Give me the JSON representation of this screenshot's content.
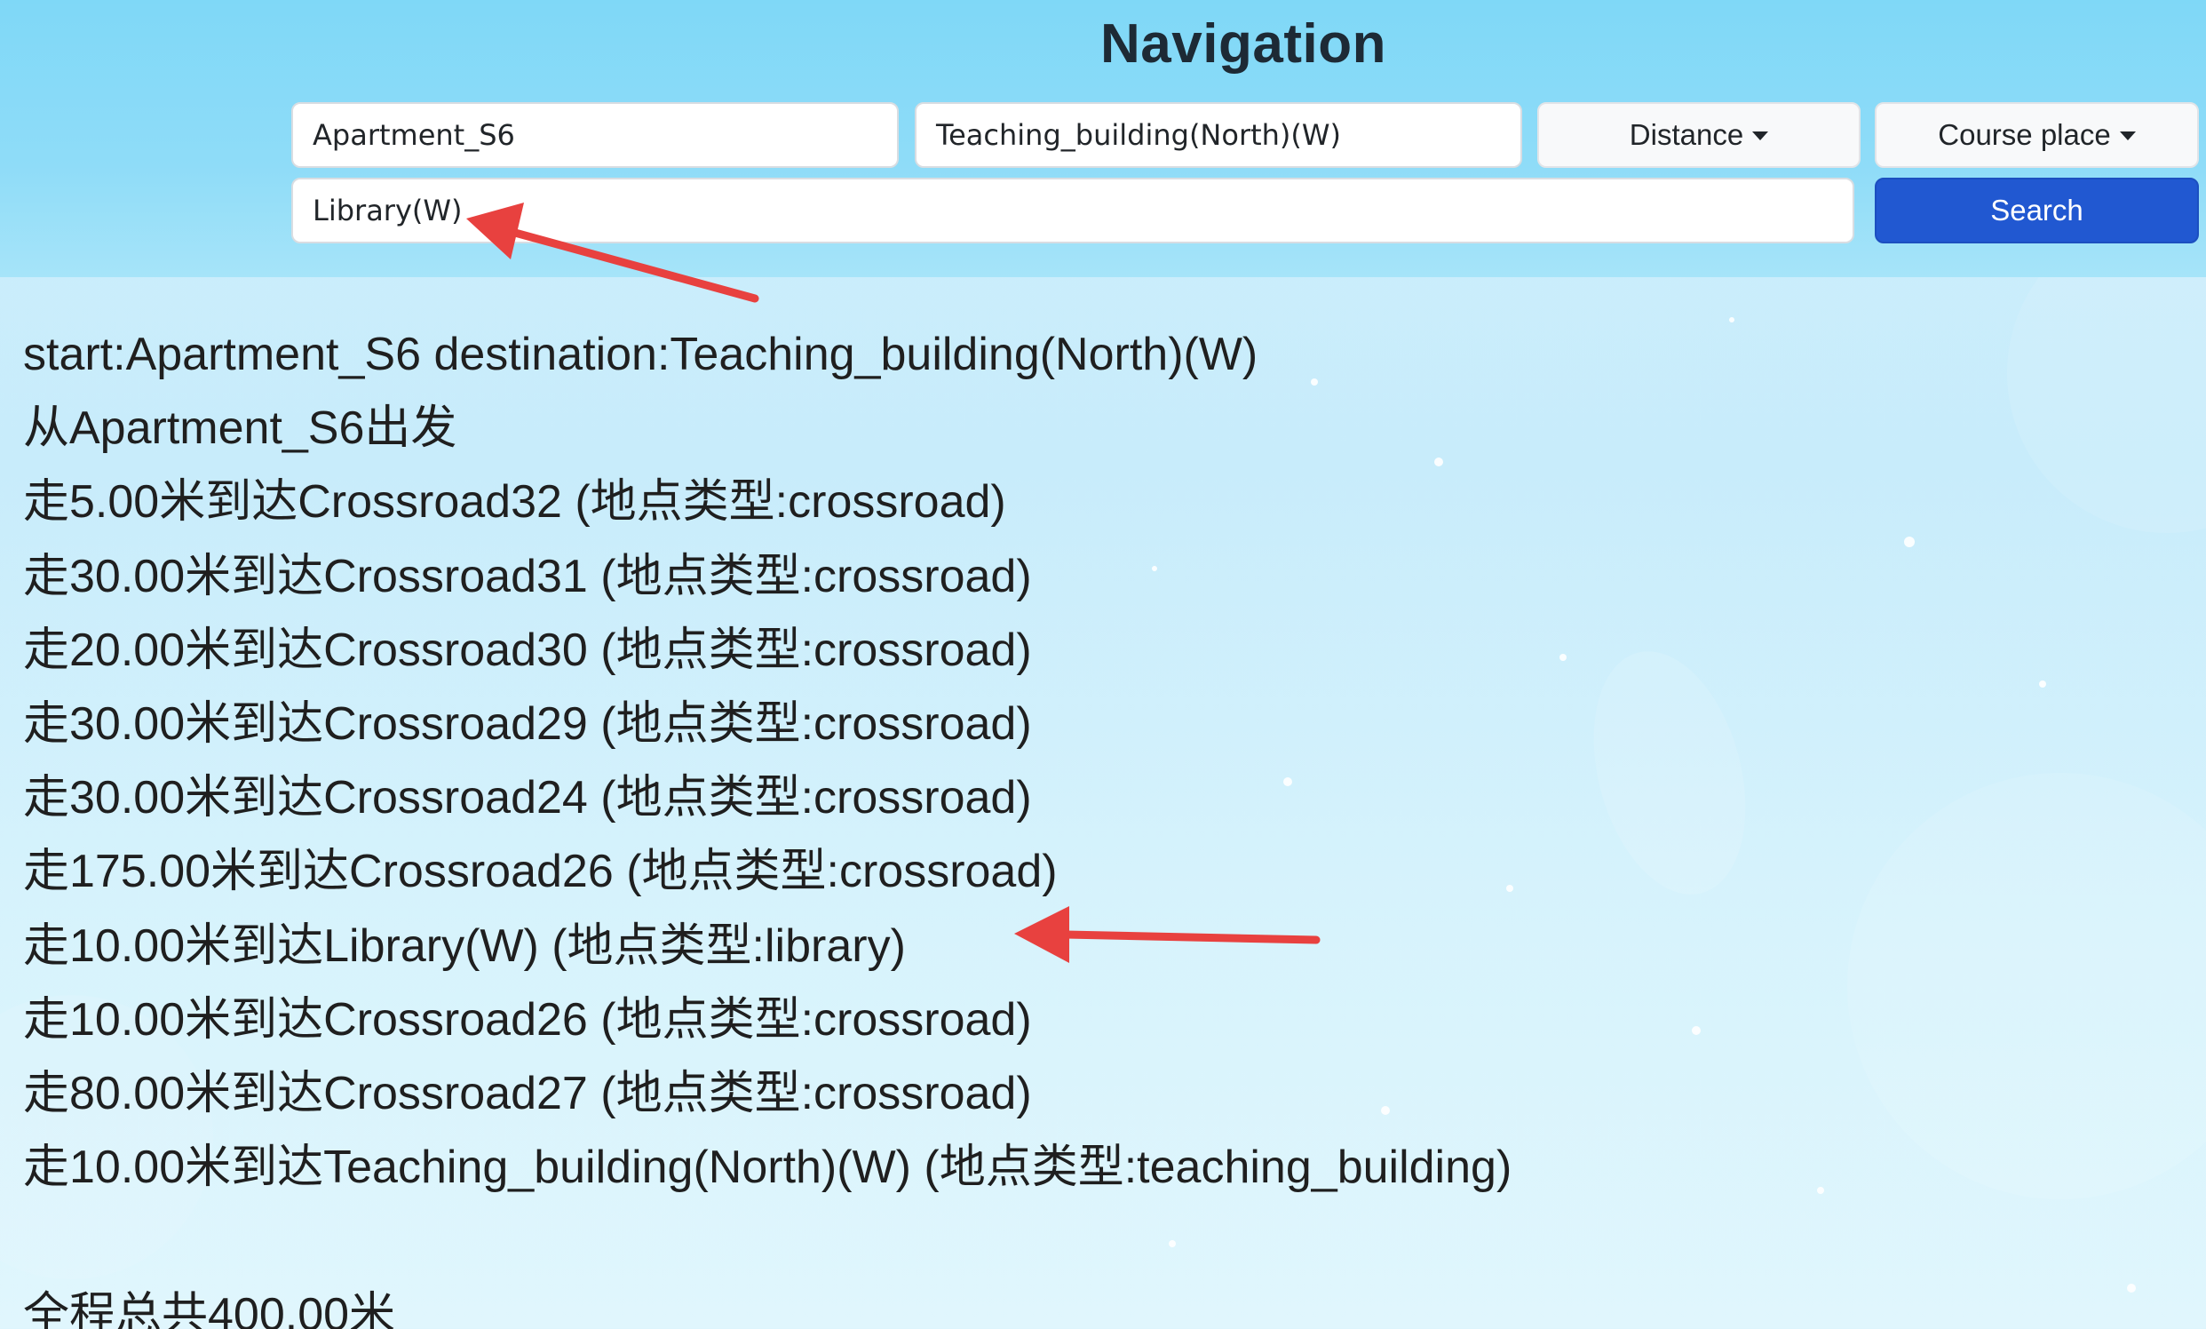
{
  "page": {
    "title": "Navigation"
  },
  "form": {
    "start_value": "Apartment_S6",
    "destination_value": "Teaching_building(North)(W)",
    "waypoint_value": "Library(W)",
    "distance_dropdown_label": "Distance",
    "course_place_dropdown_label": "Course place",
    "search_button_label": "Search"
  },
  "results": {
    "lines": [
      "start:Apartment_S6 destination:Teaching_building(North)(W)",
      "从Apartment_S6出发",
      "走5.00米到达Crossroad32 (地点类型:crossroad)",
      "走30.00米到达Crossroad31 (地点类型:crossroad)",
      "走20.00米到达Crossroad30 (地点类型:crossroad)",
      "走30.00米到达Crossroad29 (地点类型:crossroad)",
      "走30.00米到达Crossroad24 (地点类型:crossroad)",
      "走175.00米到达Crossroad26 (地点类型:crossroad)",
      "走10.00米到达Library(W) (地点类型:library)",
      "走10.00米到达Crossroad26 (地点类型:crossroad)",
      "走80.00米到达Crossroad27 (地点类型:crossroad)",
      "走10.00米到达Teaching_building(North)(W) (地点类型:teaching_building)"
    ],
    "total": "全程总共400.00米"
  },
  "colors": {
    "header_background": "#8fdcf8",
    "page_background": "#cdeffc",
    "search_button": "#2158d1",
    "annotation_arrow": "#e8413f"
  }
}
